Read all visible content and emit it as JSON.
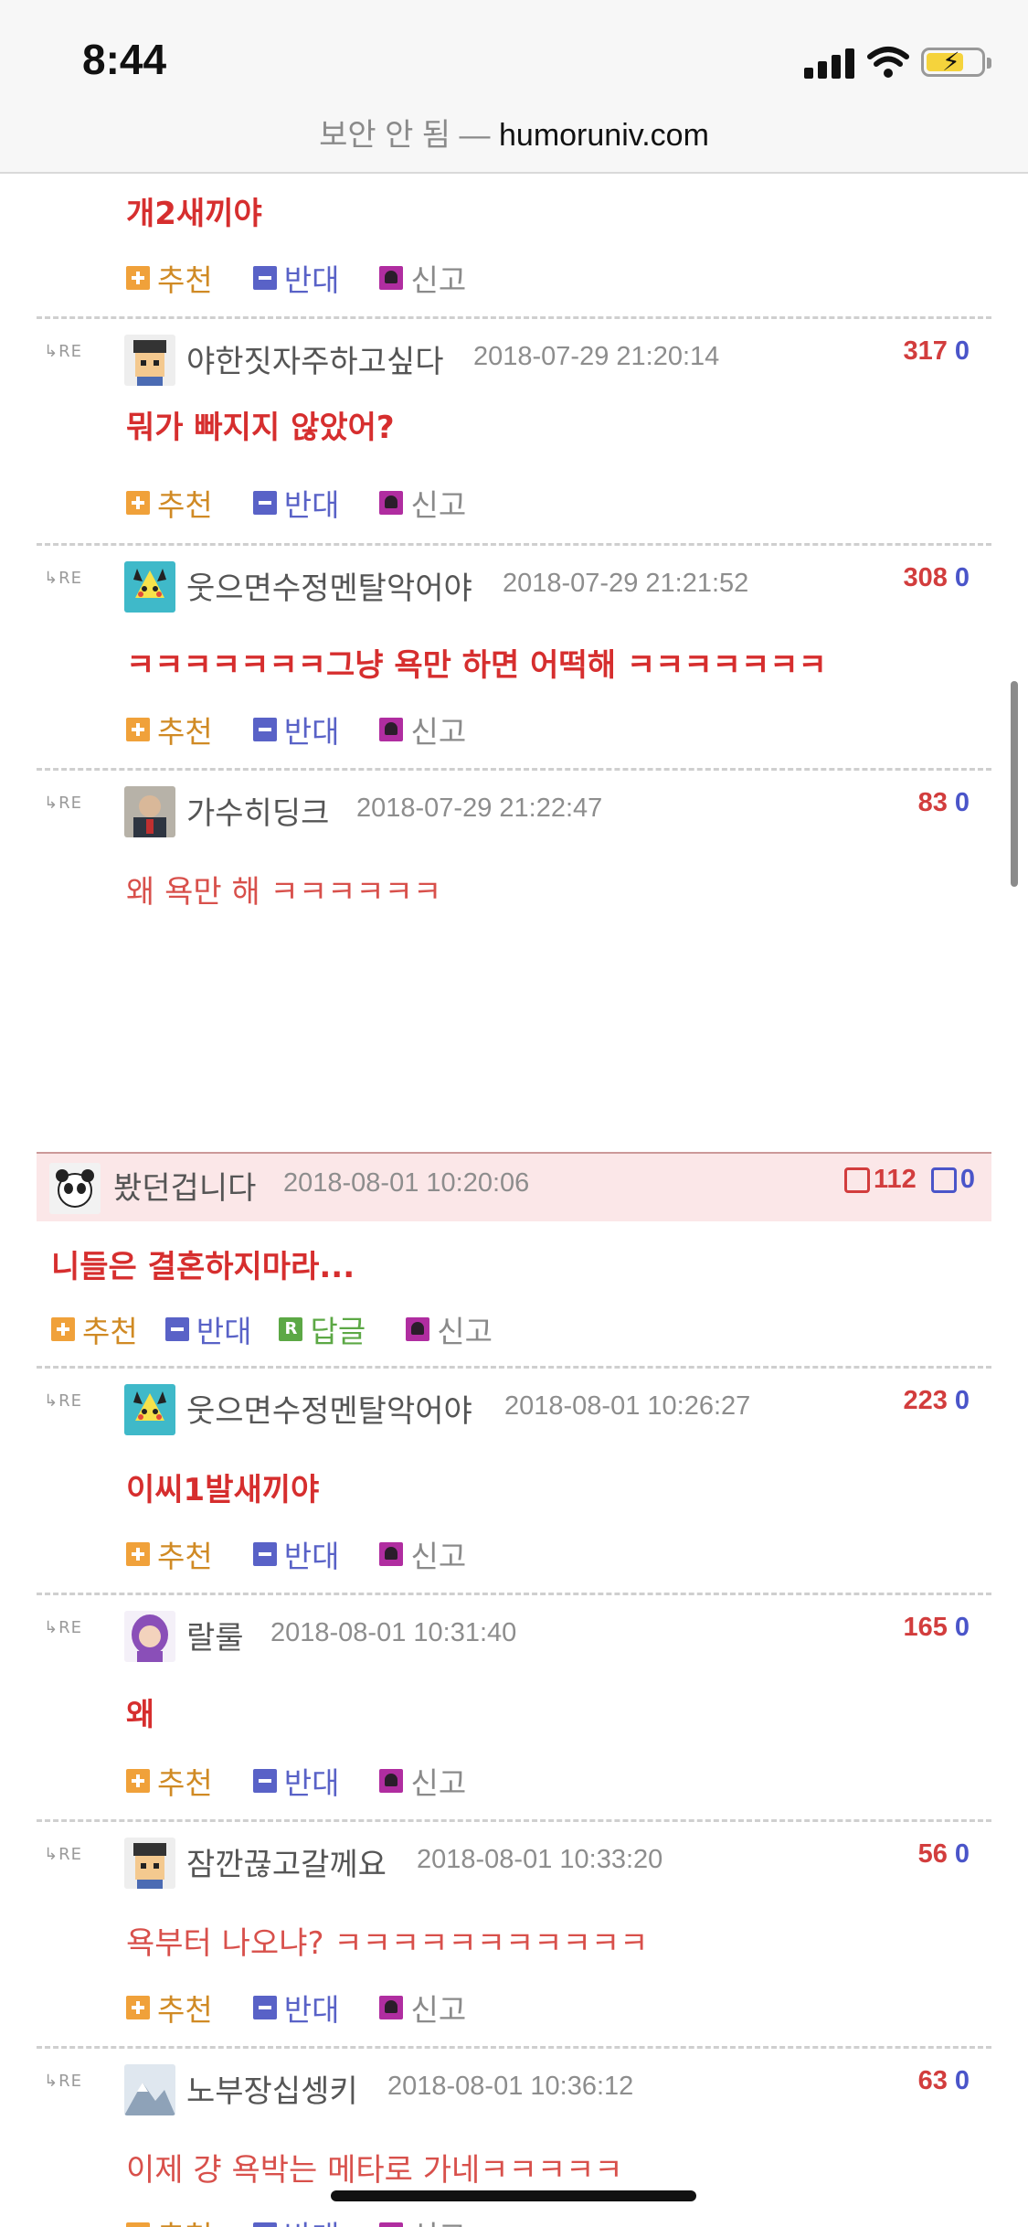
{
  "status": {
    "time": "8:44"
  },
  "url_bar": {
    "insecure_label": "보안 안 됨",
    "separator": " — ",
    "domain": "humoruniv.com"
  },
  "actions": {
    "recommend": "추천",
    "oppose": "반대",
    "report": "신고",
    "reply": "답글",
    "reply_icon_text": "R"
  },
  "reply_marker": "RE",
  "top_partial_comment": {
    "text": "개2새끼야"
  },
  "replies_group1": [
    {
      "nick": "야한짓자주하고싶다",
      "date": "2018-07-29 21:20:14",
      "up": "317",
      "down": "0",
      "text": "뭐가 빠지지 않았어?",
      "avatar": "pixel-man"
    },
    {
      "nick": "웃으면수정멘탈악어야",
      "date": "2018-07-29 21:21:52",
      "up": "308",
      "down": "0",
      "text": "ㅋㅋㅋㅋㅋㅋㅋ그냥 욕만 하면 어떡해 ㅋㅋㅋㅋㅋㅋㅋ",
      "avatar": "pikachu"
    },
    {
      "nick": "가수히딩크",
      "date": "2018-07-29 21:22:47",
      "up": "83",
      "down": "0",
      "text": "왜 욕만 해 ㅋㅋㅋㅋㅋㅋ",
      "avatar": "photo"
    }
  ],
  "main_post": {
    "nick": "봤던겁니다",
    "date": "2018-08-01 10:20:06",
    "up": "112",
    "down": "0",
    "text": "니들은 결혼하지마라..."
  },
  "replies_group2": [
    {
      "nick": "웃으면수정멘탈악어야",
      "date": "2018-08-01 10:26:27",
      "up": "223",
      "down": "0",
      "text": "이씨1발새끼야",
      "avatar": "pikachu"
    },
    {
      "nick": "랄룰",
      "date": "2018-08-01 10:31:40",
      "up": "165",
      "down": "0",
      "text": "왜",
      "avatar": "girl"
    },
    {
      "nick": "잠깐끊고갈께요",
      "date": "2018-08-01 10:33:20",
      "up": "56",
      "down": "0",
      "text": "욕부터 나오냐? ㅋㅋㅋㅋㅋㅋㅋㅋㅋㅋㅋ",
      "avatar": "pixel-man"
    },
    {
      "nick": "노부장십셍키",
      "date": "2018-08-01 10:36:12",
      "up": "63",
      "down": "0",
      "text": "이제 걍 욕박는 메타로 가네ㅋㅋㅋㅋㅋ",
      "avatar": "snow"
    }
  ],
  "colors": {
    "red_text": "#d62e2e",
    "up_count": "#d23d3d",
    "down_count": "#4a55c9",
    "header_bg": "#fbe7e8"
  }
}
